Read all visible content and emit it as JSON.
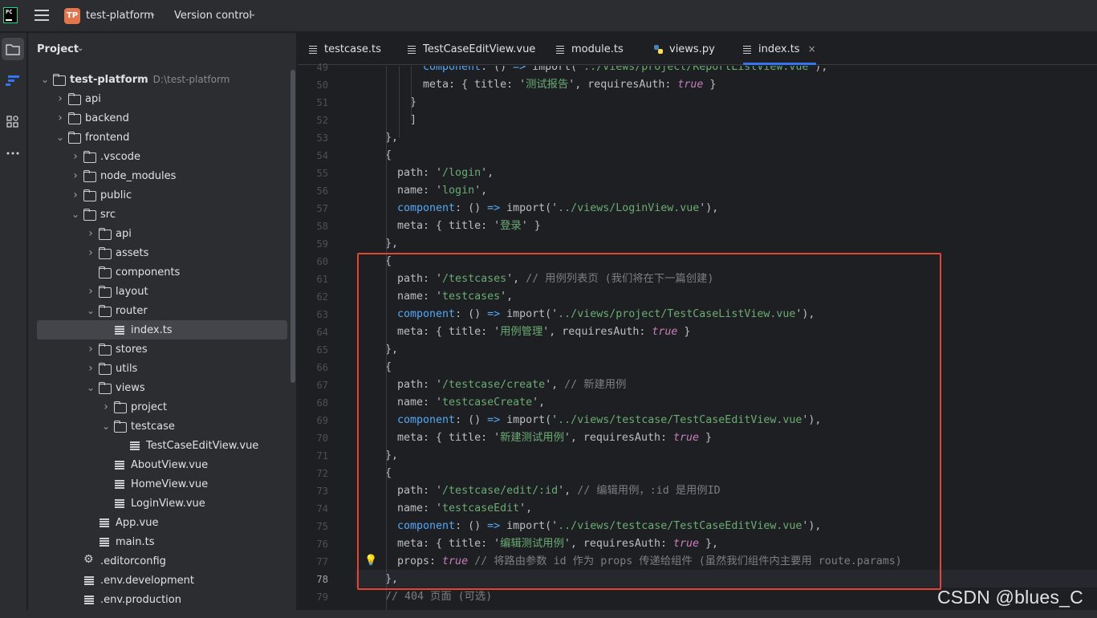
{
  "titlebar": {
    "logo_text": "PC",
    "project_avatar": "TP",
    "project_name": "test-platform",
    "vcs_label": "Version control",
    "chevron": "⌄"
  },
  "project_panel": {
    "title": "Project",
    "chevron": "⌄",
    "tree": [
      {
        "label": "test-platform",
        "path": "D:\\test-platform",
        "kind": "folder",
        "expanded": true,
        "bold": true
      },
      {
        "label": "api",
        "kind": "folder",
        "expanded": false
      },
      {
        "label": "backend",
        "kind": "folder",
        "expanded": false
      },
      {
        "label": "frontend",
        "kind": "folder",
        "expanded": true
      },
      {
        "label": ".vscode",
        "kind": "folder",
        "expanded": false
      },
      {
        "label": "node_modules",
        "kind": "folder",
        "expanded": false
      },
      {
        "label": "public",
        "kind": "folder",
        "expanded": false
      },
      {
        "label": "src",
        "kind": "folder",
        "expanded": true
      },
      {
        "label": "api",
        "kind": "folder",
        "expanded": false
      },
      {
        "label": "assets",
        "kind": "folder",
        "expanded": false
      },
      {
        "label": "components",
        "kind": "folder",
        "expanded": null
      },
      {
        "label": "layout",
        "kind": "folder",
        "expanded": false
      },
      {
        "label": "router",
        "kind": "folder",
        "expanded": true
      },
      {
        "label": "index.ts",
        "kind": "file",
        "selected": true
      },
      {
        "label": "stores",
        "kind": "folder",
        "expanded": false
      },
      {
        "label": "utils",
        "kind": "folder",
        "expanded": false
      },
      {
        "label": "views",
        "kind": "folder",
        "expanded": true
      },
      {
        "label": "project",
        "kind": "folder",
        "expanded": false
      },
      {
        "label": "testcase",
        "kind": "folder",
        "expanded": true
      },
      {
        "label": "TestCaseEditView.vue",
        "kind": "file"
      },
      {
        "label": "AboutView.vue",
        "kind": "file"
      },
      {
        "label": "HomeView.vue",
        "kind": "file"
      },
      {
        "label": "LoginView.vue",
        "kind": "file"
      },
      {
        "label": "App.vue",
        "kind": "file"
      },
      {
        "label": "main.ts",
        "kind": "file"
      },
      {
        "label": ".editorconfig",
        "kind": "config"
      },
      {
        "label": ".env.development",
        "kind": "file"
      },
      {
        "label": ".env.production",
        "kind": "file"
      }
    ]
  },
  "tabs": [
    {
      "label": "testcase.ts",
      "icon": "file-icon",
      "active": false
    },
    {
      "label": "TestCaseEditView.vue",
      "icon": "file-icon",
      "active": false
    },
    {
      "label": "module.ts",
      "icon": "file-icon",
      "active": false
    },
    {
      "label": "views.py",
      "icon": "python-icon",
      "active": false
    },
    {
      "label": "index.ts",
      "icon": "file-icon",
      "active": true,
      "closable": true,
      "close_glyph": "×"
    }
  ],
  "editor": {
    "current_line": "78",
    "lines": [
      {
        "n": "49",
        "parts": [
          [
            "k",
            "component"
          ],
          [
            "f",
            ": () "
          ],
          [
            "k",
            "=>"
          ],
          [
            "f",
            " import('"
          ],
          [
            "s",
            "../views/project/ReportListView.vue"
          ],
          [
            "f",
            "'),"
          ]
        ]
      },
      {
        "n": "50",
        "parts": [
          [
            "f",
            "meta: { title: '"
          ],
          [
            "s",
            "测试报告"
          ],
          [
            "f",
            "', requiresAuth: "
          ],
          [
            "b",
            "true"
          ],
          [
            "f",
            " }"
          ]
        ]
      },
      {
        "n": "51",
        "parts": [
          [
            "f",
            "}"
          ]
        ]
      },
      {
        "n": "52",
        "parts": [
          [
            "f",
            "]"
          ]
        ]
      },
      {
        "n": "53",
        "parts": [
          [
            "f",
            "},"
          ]
        ]
      },
      {
        "n": "54",
        "parts": [
          [
            "f",
            "{"
          ]
        ]
      },
      {
        "n": "55",
        "parts": [
          [
            "f",
            "path: '"
          ],
          [
            "s",
            "/login"
          ],
          [
            "f",
            "',"
          ]
        ]
      },
      {
        "n": "56",
        "parts": [
          [
            "f",
            "name: '"
          ],
          [
            "s",
            "login"
          ],
          [
            "f",
            "',"
          ]
        ]
      },
      {
        "n": "57",
        "parts": [
          [
            "k",
            "component"
          ],
          [
            "f",
            ": () "
          ],
          [
            "k",
            "=>"
          ],
          [
            "f",
            " import('"
          ],
          [
            "s",
            "../views/LoginView.vue"
          ],
          [
            "f",
            "'),"
          ]
        ]
      },
      {
        "n": "58",
        "parts": [
          [
            "f",
            "meta: { title: '"
          ],
          [
            "s",
            "登录"
          ],
          [
            "f",
            "' }"
          ]
        ]
      },
      {
        "n": "59",
        "parts": [
          [
            "f",
            "},"
          ]
        ]
      },
      {
        "n": "60",
        "parts": [
          [
            "f",
            "{"
          ]
        ]
      },
      {
        "n": "61",
        "parts": [
          [
            "f",
            "path: '"
          ],
          [
            "s",
            "/testcases"
          ],
          [
            "f",
            "', "
          ],
          [
            "c",
            "// 用例列表页 (我们将在下一篇创建)"
          ]
        ]
      },
      {
        "n": "62",
        "parts": [
          [
            "f",
            "name: '"
          ],
          [
            "s",
            "testcases"
          ],
          [
            "f",
            "',"
          ]
        ]
      },
      {
        "n": "63",
        "parts": [
          [
            "k",
            "component"
          ],
          [
            "f",
            ": () "
          ],
          [
            "k",
            "=>"
          ],
          [
            "f",
            " import('"
          ],
          [
            "s",
            "../views/project/TestCaseListView.vue"
          ],
          [
            "f",
            "'),"
          ]
        ]
      },
      {
        "n": "64",
        "parts": [
          [
            "f",
            "meta: { title: '"
          ],
          [
            "s",
            "用例管理"
          ],
          [
            "f",
            "', requiresAuth: "
          ],
          [
            "b",
            "true"
          ],
          [
            "f",
            " }"
          ]
        ]
      },
      {
        "n": "65",
        "parts": [
          [
            "f",
            "},"
          ]
        ]
      },
      {
        "n": "66",
        "parts": [
          [
            "f",
            "{"
          ]
        ]
      },
      {
        "n": "67",
        "parts": [
          [
            "f",
            "path: '"
          ],
          [
            "s",
            "/testcase/create"
          ],
          [
            "f",
            "', "
          ],
          [
            "c",
            "// 新建用例"
          ]
        ]
      },
      {
        "n": "68",
        "parts": [
          [
            "f",
            "name: '"
          ],
          [
            "s",
            "testcaseCreate"
          ],
          [
            "f",
            "',"
          ]
        ]
      },
      {
        "n": "69",
        "parts": [
          [
            "k",
            "component"
          ],
          [
            "f",
            ": () "
          ],
          [
            "k",
            "=>"
          ],
          [
            "f",
            " import('"
          ],
          [
            "s",
            "../views/testcase/TestCaseEditView.vue"
          ],
          [
            "f",
            "'),"
          ]
        ]
      },
      {
        "n": "70",
        "parts": [
          [
            "f",
            "meta: { title: '"
          ],
          [
            "s",
            "新建测试用例"
          ],
          [
            "f",
            "', requiresAuth: "
          ],
          [
            "b",
            "true"
          ],
          [
            "f",
            " }"
          ]
        ]
      },
      {
        "n": "71",
        "parts": [
          [
            "f",
            "},"
          ]
        ]
      },
      {
        "n": "72",
        "parts": [
          [
            "f",
            "{"
          ]
        ]
      },
      {
        "n": "73",
        "parts": [
          [
            "f",
            "path: '"
          ],
          [
            "s",
            "/testcase/edit/:id"
          ],
          [
            "f",
            "', "
          ],
          [
            "c",
            "// 编辑用例，:id 是用例ID"
          ]
        ]
      },
      {
        "n": "74",
        "parts": [
          [
            "f",
            "name: '"
          ],
          [
            "s",
            "testcaseEdit"
          ],
          [
            "f",
            "',"
          ]
        ]
      },
      {
        "n": "75",
        "parts": [
          [
            "k",
            "component"
          ],
          [
            "f",
            ": () "
          ],
          [
            "k",
            "=>"
          ],
          [
            "f",
            " import('"
          ],
          [
            "s",
            "../views/testcase/TestCaseEditView.vue"
          ],
          [
            "f",
            "'),"
          ]
        ]
      },
      {
        "n": "76",
        "parts": [
          [
            "f",
            "meta: { title: '"
          ],
          [
            "s",
            "编辑测试用例"
          ],
          [
            "f",
            "', requiresAuth: "
          ],
          [
            "b",
            "true"
          ],
          [
            "f",
            " },"
          ]
        ]
      },
      {
        "n": "77",
        "parts": [
          [
            "f",
            "props: "
          ],
          [
            "b",
            "true"
          ],
          [
            "f",
            " "
          ],
          [
            "c",
            "// 将路由参数 id 作为 props 传递给组件 (虽然我们组件内主要用 route.params)"
          ]
        ]
      },
      {
        "n": "78",
        "parts": [
          [
            "f",
            "},"
          ]
        ]
      },
      {
        "n": "79",
        "parts": [
          [
            "c",
            "// 404 页面 (可选)"
          ]
        ]
      }
    ]
  },
  "watermark": "CSDN @blues_C"
}
